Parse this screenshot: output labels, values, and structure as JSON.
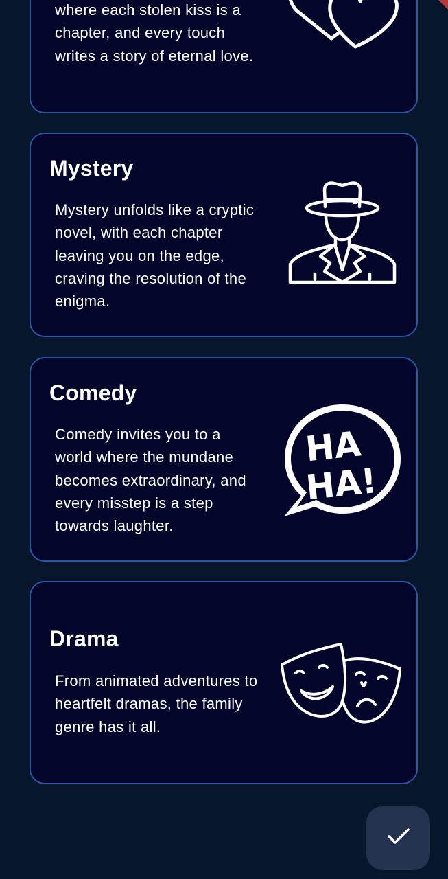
{
  "genres": [
    {
      "title": "",
      "description": "where each stolen kiss is a chapter, and every touch writes a story of eternal love.",
      "icon": "hearts-icon"
    },
    {
      "title": "Mystery",
      "description": "Mystery unfolds like a cryptic novel, with each chapter leaving you on the edge, craving the resolution of the enigma.",
      "icon": "detective-icon"
    },
    {
      "title": "Comedy",
      "description": "Comedy invites you to a world where the mundane becomes extraordinary, and every misstep is a step towards laughter.",
      "icon": "haha-speech-bubble-icon"
    },
    {
      "title": "Drama",
      "description": "From animated adventures to heartfelt dramas, the family genre has it all.",
      "icon": "theater-masks-icon"
    }
  ],
  "fab": {
    "icon": "checkmark-icon"
  },
  "colors": {
    "background": "#08162b",
    "card_background": "#03052a",
    "card_border": "#2a56a8",
    "fab_background": "#25324f",
    "text": "#ffffff",
    "accent_flag": "#b43a3a"
  }
}
